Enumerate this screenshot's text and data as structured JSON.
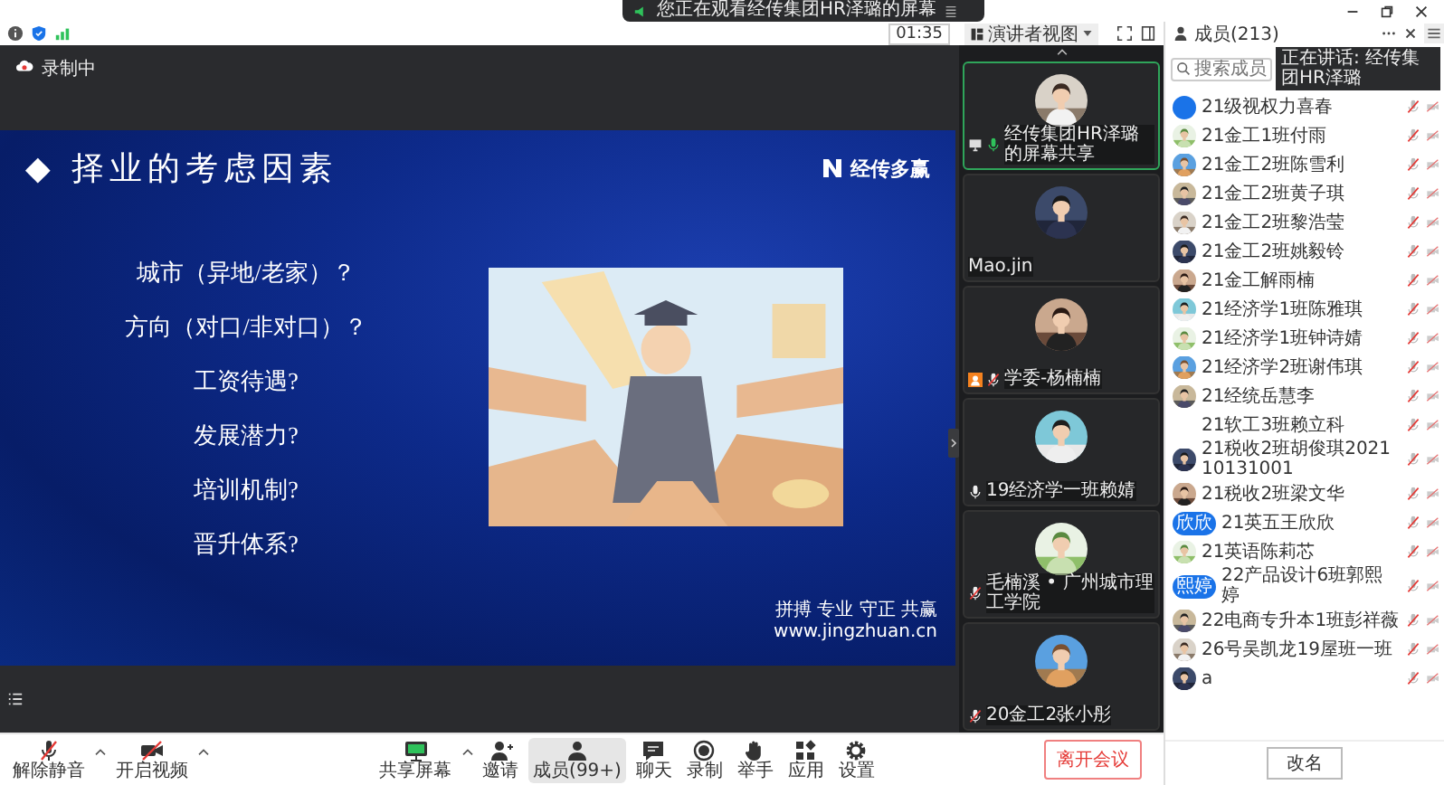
{
  "banner": {
    "text": "您正在观看经传集团HR泽璐的屏幕"
  },
  "top_bar": {
    "timer": "01:35",
    "view_button": "演讲者视图"
  },
  "recording": {
    "label": "录制中"
  },
  "slide": {
    "title_mark": "◆",
    "title": "择业的考虑因素",
    "logo": "经传多赢",
    "items": [
      "城市（异地/老家）？",
      "方向（对口/非对口）？",
      "工资待遇?",
      "发展潜力?",
      "培训机制?",
      "晋升体系?"
    ],
    "motto": "拼搏 专业 守正 共赢",
    "url": "www.jingzhuan.cn"
  },
  "video_tiles": [
    {
      "name": "经传集团HR泽璐的屏幕共享",
      "mic_shown": true,
      "muted": false,
      "speaking": true,
      "sharing": true,
      "host": false,
      "selected": true
    },
    {
      "name": "Mao.jin",
      "mic_shown": false,
      "sharing": false,
      "host": false,
      "selected": false
    },
    {
      "name": "学委-杨楠楠",
      "mic_shown": true,
      "muted": true,
      "speaking": false,
      "sharing": false,
      "host": true,
      "selected": false
    },
    {
      "name": "19经济学一班赖婧",
      "mic_shown": true,
      "muted": false,
      "speaking": false,
      "sharing": false,
      "host": false,
      "selected": false
    },
    {
      "name": "毛楠溪 • 广州城市理工学院",
      "mic_shown": true,
      "muted": true,
      "speaking": false,
      "sharing": false,
      "host": false,
      "selected": false
    },
    {
      "name": "20金工2张小彤",
      "mic_shown": true,
      "muted": true,
      "speaking": false,
      "sharing": false,
      "host": false,
      "selected": false
    }
  ],
  "toolbar": {
    "items": [
      {
        "kind": "mic-off",
        "label": "解除静音",
        "caret": true,
        "selected": false
      },
      {
        "kind": "video-off",
        "label": "开启视频",
        "caret": true,
        "selected": false
      },
      {
        "kind": "share",
        "label": "共享屏幕",
        "caret": true,
        "selected": false
      },
      {
        "kind": "invite",
        "label": "邀请",
        "caret": false,
        "selected": false
      },
      {
        "kind": "members",
        "label": "成员(99+)",
        "caret": false,
        "selected": true
      },
      {
        "kind": "chat",
        "label": "聊天",
        "caret": false,
        "selected": false
      },
      {
        "kind": "record",
        "label": "录制",
        "caret": false,
        "selected": false
      },
      {
        "kind": "hand",
        "label": "举手",
        "caret": false,
        "selected": false
      },
      {
        "kind": "apps",
        "label": "应用",
        "caret": false,
        "selected": false
      },
      {
        "kind": "settings",
        "label": "设置",
        "caret": false,
        "selected": false
      }
    ],
    "leave_button": "离开会议"
  },
  "members": {
    "title": "成员(213)",
    "search": {
      "placeholder": "搜索成员"
    },
    "speaking_tooltip": "正在讲话: 经传集团HR泽璐",
    "rename_button": "改名",
    "items": [
      {
        "name": "21级视权力喜春",
        "kind": "initials"
      },
      {
        "name": "21金工1班付雨"
      },
      {
        "name": "21金工2班陈雪利"
      },
      {
        "name": "21金工2班黄子琪"
      },
      {
        "name": "21金工2班黎浩莹"
      },
      {
        "name": "21金工2班姚毅铃"
      },
      {
        "name": "21金工解雨楠"
      },
      {
        "name": "21经济学1班陈雅琪"
      },
      {
        "name": "21经济学1班钟诗婧"
      },
      {
        "name": "21经济学2班谢伟琪"
      },
      {
        "name": "21经统岳慧李"
      },
      {
        "name": "21软工3班赖立科",
        "kind": "blank"
      },
      {
        "name": "21税收2班胡俊琪202110131001"
      },
      {
        "name": "21税收2班梁文华"
      },
      {
        "name": "21英五王欣欣",
        "kind": "initials",
        "initials": "欣欣"
      },
      {
        "name": "21英语陈莉芯"
      },
      {
        "name": "22产品设计6班郭熙婷",
        "kind": "initials",
        "initials": "熙婷"
      },
      {
        "name": "22电商专升本1班彭祥薇"
      },
      {
        "name": "26号吴凯龙19屋班一班"
      },
      {
        "name": "a"
      }
    ]
  }
}
